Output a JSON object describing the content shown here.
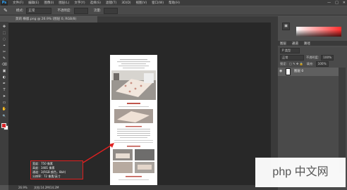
{
  "menubar": {
    "logo": "Ps",
    "items": [
      "文件(F)",
      "编辑(E)",
      "图像(I)",
      "图层(L)",
      "文字(Y)",
      "选择(S)",
      "滤镜(T)",
      "3D(D)",
      "视图(V)",
      "窗口(W)",
      "帮助(H)"
    ],
    "window_controls": [
      "—",
      "□",
      "✕"
    ]
  },
  "options": {
    "tool_glyph": "✎",
    "mode_label": "模式:",
    "mode_value": "正常",
    "opacity_label": "不透明度:",
    "flow_label": "流量:"
  },
  "document": {
    "tab_title": "莫莉 横版.png @ 26.9% (图层 0, RGB/8)"
  },
  "tools": [
    "✥",
    "⬚",
    "◌",
    "⌖",
    "✂",
    "✎",
    "⌫",
    "▣",
    "◐",
    "✒",
    "T",
    "➤",
    "▭",
    "✋",
    "🔍"
  ],
  "colors": {
    "foreground": "#d9262a",
    "background": "#ffffff",
    "canvas": "#282828"
  },
  "status": {
    "zoom": "26.9%",
    "doc_info": "文档:14.2M/14.2M"
  },
  "info_box": {
    "lines": [
      "宽度：750 像素",
      "高度：3481 像素",
      "通道：3(RGB 颜色，8bit)",
      "分辨率：72 像素/英寸"
    ]
  },
  "layers_panel": {
    "tabs": [
      "图层",
      "通道",
      "路径"
    ],
    "filter_label": "P 类型",
    "blend_mode": "正常",
    "opacity_label": "不透明度:",
    "opacity_value": "100%",
    "lock_label": "锁定:",
    "fill_label": "填充:",
    "fill_value": "100%",
    "layer_name": "图层 0"
  },
  "watermark": "php 中文网"
}
